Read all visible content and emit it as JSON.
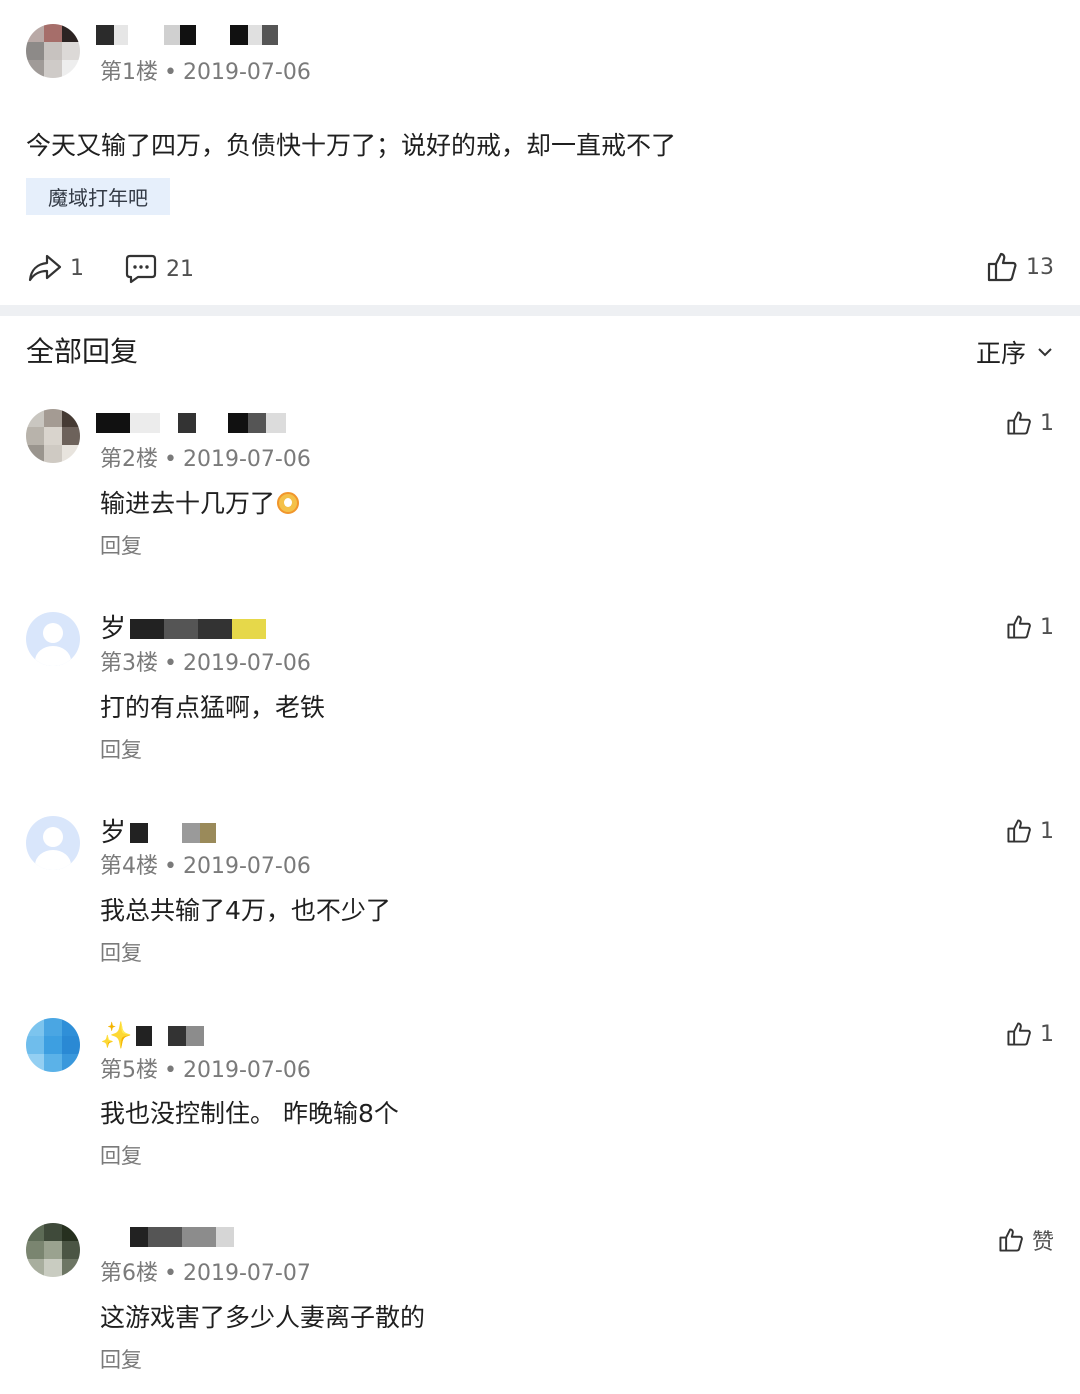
{
  "post": {
    "floor_label": "第1楼",
    "date": "2019-07-06",
    "separator": "•",
    "text": "今天又输了四万，负债快十万了；说好的戒，却一直戒不了",
    "tag": "魔域打年吧",
    "share_count": "1",
    "comment_count": "21",
    "like_count": "13"
  },
  "replies_header": {
    "title": "全部回复",
    "sort_label": "正序"
  },
  "replies": [
    {
      "floor": "第2楼",
      "date": "2019-07-06",
      "text": "输进去十几万了",
      "reply_label": "回复",
      "likes": "1",
      "name_prefix": ""
    },
    {
      "floor": "第3楼",
      "date": "2019-07-06",
      "text": "打的有点猛啊，老铁",
      "reply_label": "回复",
      "likes": "1",
      "name_prefix": "岁"
    },
    {
      "floor": "第4楼",
      "date": "2019-07-06",
      "text": "我总共输了4万，也不少了",
      "reply_label": "回复",
      "likes": "1",
      "name_prefix": "岁"
    },
    {
      "floor": "第5楼",
      "date": "2019-07-06",
      "text": "我也没控制住。 昨晚输8个",
      "reply_label": "回复",
      "likes": "1",
      "name_prefix": "✨"
    },
    {
      "floor": "第6楼",
      "date": "2019-07-07",
      "text": "这游戏害了多少人妻离子散的",
      "reply_label": "回复",
      "likes": "赞",
      "name_prefix": ""
    }
  ],
  "colors": {
    "avatar_default_bg": "#d9e6fb",
    "tag_bg": "#e6effb",
    "divider": "#eef0f3"
  }
}
